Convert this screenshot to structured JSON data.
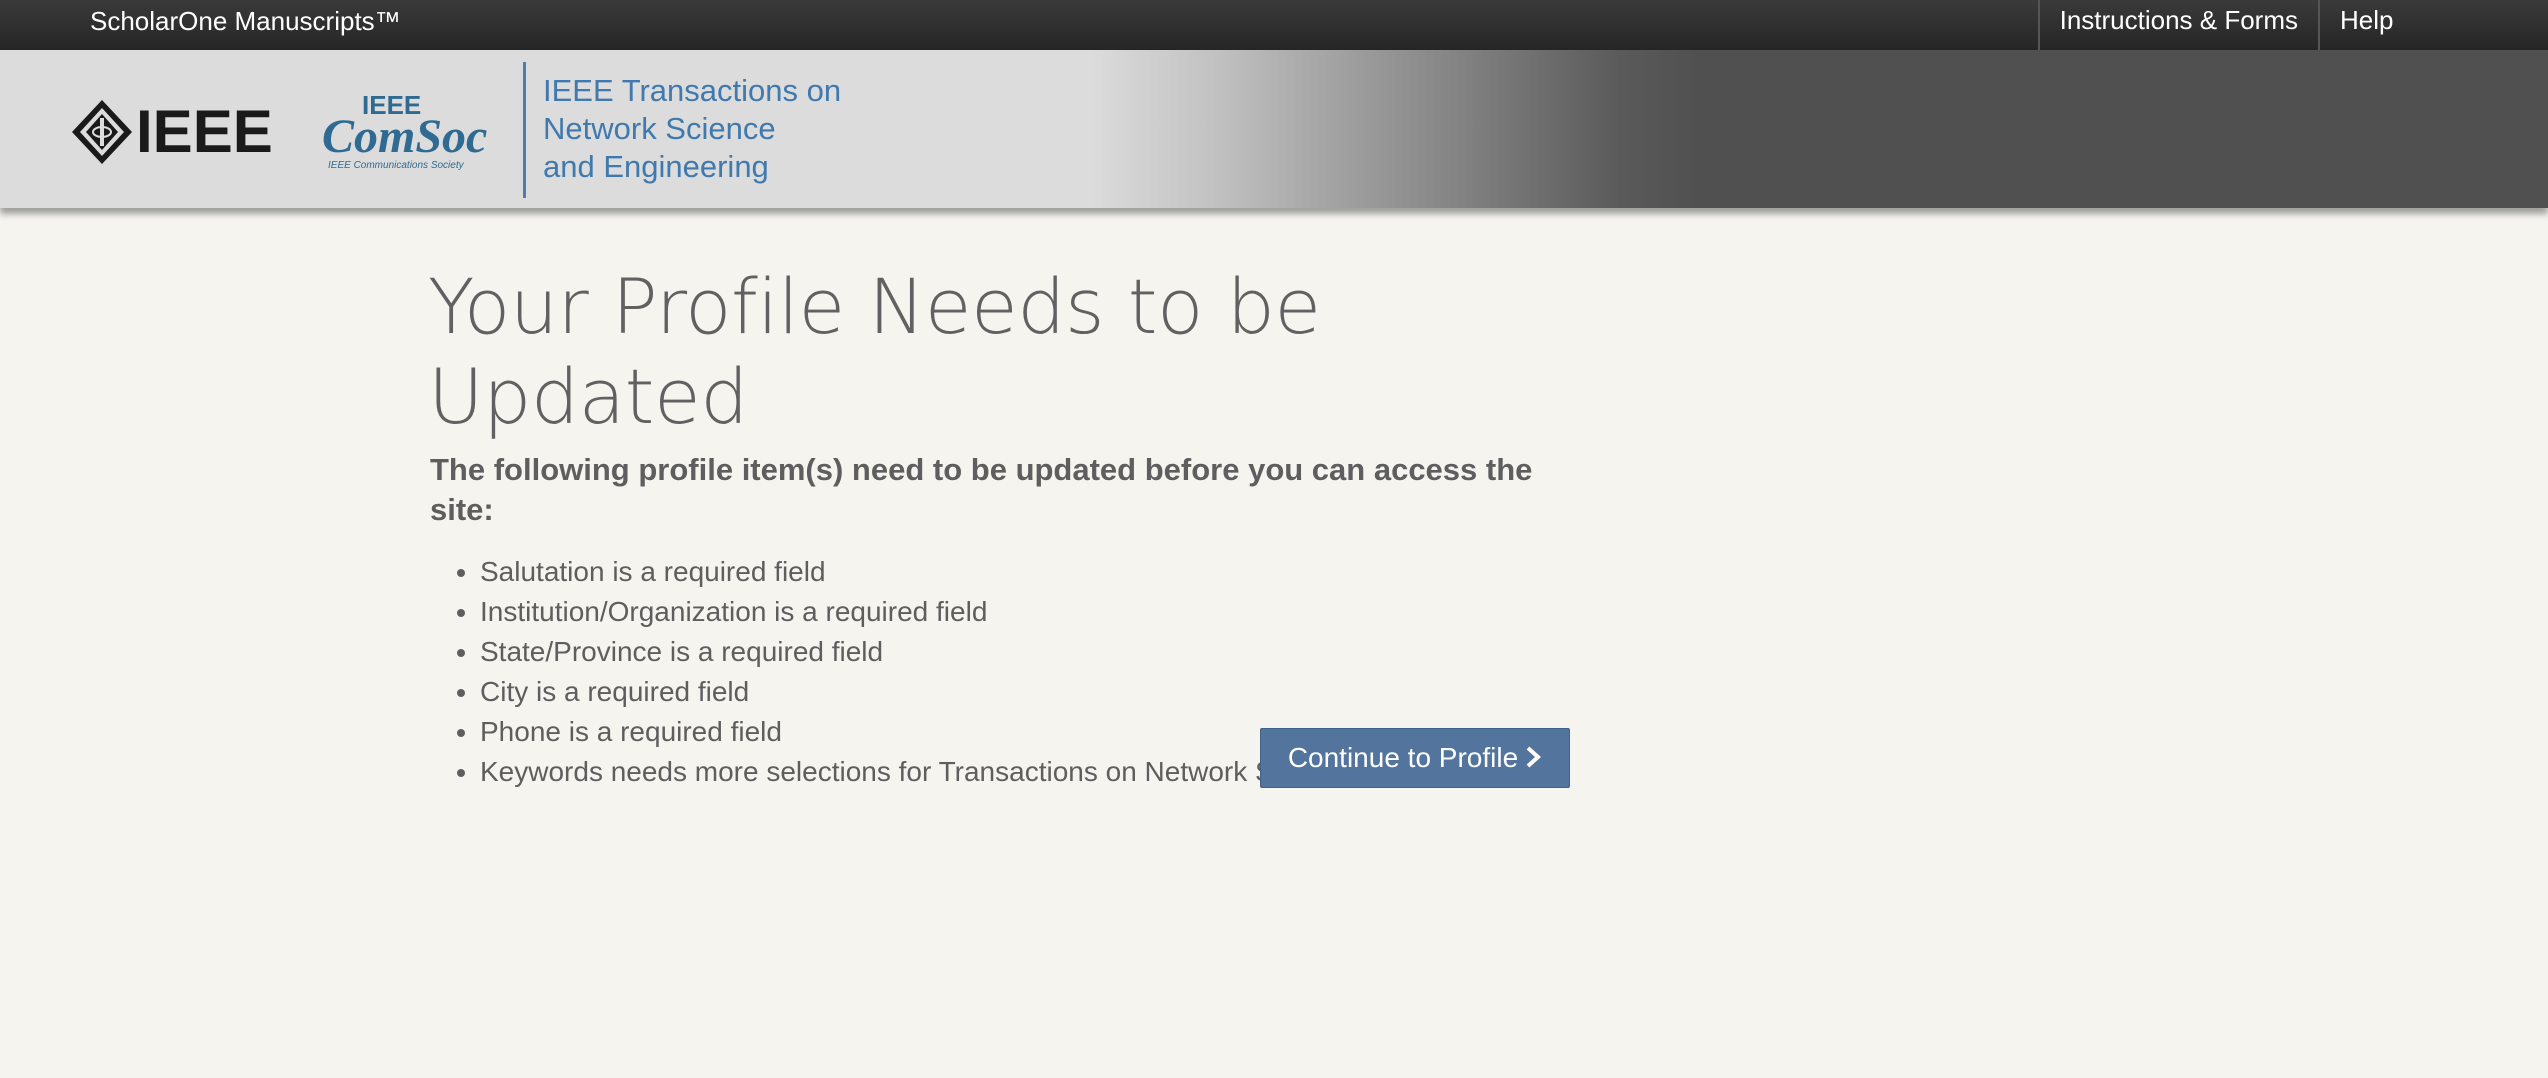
{
  "topbar": {
    "brand": "ScholarOne Manuscripts™",
    "nav": [
      {
        "label": "Instructions & Forms"
      },
      {
        "label": "Help"
      }
    ]
  },
  "header": {
    "ieee_logo_text": "IEEE",
    "comsoc_logo": {
      "top": "IEEE",
      "main": "ComSoc",
      "sub": "IEEE Communications Society"
    },
    "journal_title_lines": [
      "IEEE Transactions on",
      "Network Science",
      "and Engineering"
    ],
    "accent_color": "#3f79ad"
  },
  "main": {
    "title": "Your Profile Needs to be Updated",
    "subtitle": "The following profile item(s) need to be updated before you can access the site:",
    "issues": [
      "Salutation is a required field",
      "Institution/Organization is a required field",
      "State/Province is a required field",
      "City is a required field",
      "Phone is a required field",
      "Keywords needs more selections for Transactions on Network Science and Engineering"
    ],
    "continue_button": {
      "label": "Continue to Profile",
      "icon": "chevron-right-icon",
      "color": "#52749d"
    }
  }
}
